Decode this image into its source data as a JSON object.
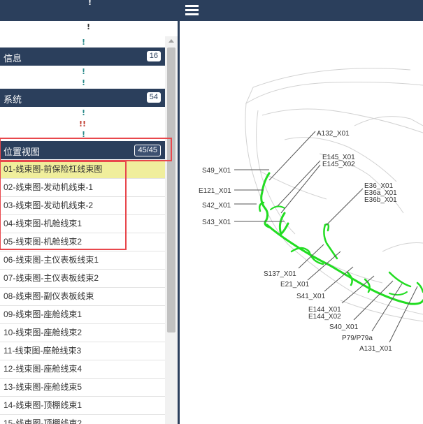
{
  "left_panel": {
    "sections": {
      "info": {
        "label": "信息",
        "count": "16"
      },
      "system": {
        "label": "系统",
        "count": "54"
      },
      "location": {
        "label": "位置视图",
        "count": "45/45"
      }
    },
    "marks": [
      "!",
      "!",
      "!",
      "!",
      "!",
      "!",
      "!!",
      "!"
    ],
    "list_items": [
      "01-线束图-前保险杠线束图",
      "02-线束图-发动机线束-1",
      "03-线束图-发动机线束-2",
      "04-线束图-机舱线束1",
      "05-线束图-机舱线束2",
      "06-线束图-主仪表板线束1",
      "07-线束图-主仪表板线束2",
      "08-线束图-副仪表板线束",
      "09-线束图-座舱线束1",
      "10-线束图-座舱线束2",
      "11-线束图-座舱线束3",
      "12-线束图-座舱线束4",
      "13-线束图-座舱线束5",
      "14-线束图-顶棚线束1",
      "15-线束图-顶棚线束2"
    ],
    "selected_index": 0
  },
  "diagram_labels": {
    "a132": "A132_X01",
    "e145_x01": "E145_X01",
    "e145_x02": "E145_X02",
    "s49": "S49_X01",
    "e121": "E121_X01",
    "s42": "S42_X01",
    "s43": "S43_X01",
    "e36": "E36_X01",
    "e36a": "E36a_X01",
    "e36b": "E36b_X01",
    "s137": "S137_X01",
    "e21": "E21_X01",
    "s41": "S41_X01",
    "e144_x01": "E144_X01",
    "e144_x02": "E144_X02",
    "s40": "S40_X01",
    "p79": "P79/P79a",
    "a131": "A131_X01"
  },
  "colors": {
    "header": "#2b3f5c",
    "selected": "#f0ee9c",
    "harness": "#22dd22",
    "highlight": "#e8474c"
  },
  "icons": {
    "menu": "hamburger-menu-icon"
  }
}
